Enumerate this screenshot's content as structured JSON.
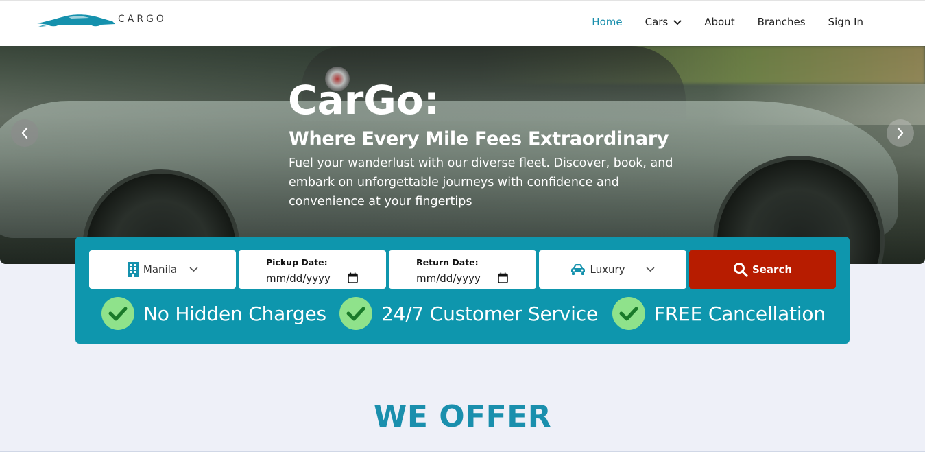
{
  "brand": {
    "name": "CarGo",
    "logo_text": "CARGO",
    "logo_icon": "car-silhouette-icon",
    "accent": "#1a8fad"
  },
  "nav": {
    "items": [
      {
        "label": "Home",
        "active": true
      },
      {
        "label": "Cars",
        "dropdown": true
      },
      {
        "label": "About"
      },
      {
        "label": "Branches"
      },
      {
        "label": "Sign In"
      }
    ]
  },
  "hero": {
    "title": "CarGo:",
    "subtitle": "Where Every Mile Fees Extraordinary",
    "description": "Fuel your wanderlust with our diverse fleet. Discover, book, and embark on unforgettable journeys with confidence and convenience at your fingertips",
    "prev_icon": "chevron-left-icon",
    "next_icon": "chevron-right-icon"
  },
  "search": {
    "location": {
      "value": "Manila",
      "icon": "building-icon"
    },
    "pickup": {
      "label": "Pickup Date:",
      "value": "mm/dd/yyyy",
      "icon": "calendar-icon"
    },
    "return": {
      "label": "Return Date:",
      "value": "mm/dd/yyyy",
      "icon": "calendar-icon"
    },
    "car_type": {
      "value": "Luxury",
      "icon": "car-icon"
    },
    "button": {
      "label": "Search",
      "icon": "search-icon",
      "color": "#b71c00"
    },
    "panel_color": "#0e96ad"
  },
  "features": [
    {
      "label": "No Hidden Charges",
      "icon": "check-circle-icon"
    },
    {
      "label": "24/7 Customer Service",
      "icon": "check-circle-icon"
    },
    {
      "label": "FREE Cancellation",
      "icon": "check-circle-icon"
    }
  ],
  "section": {
    "title": "WE OFFER"
  }
}
